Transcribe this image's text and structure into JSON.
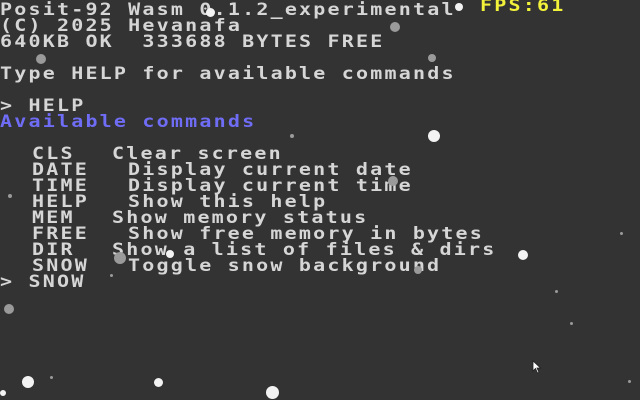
{
  "header": {
    "title": "Posit-92 Wasm 0.1.2_experimental",
    "copyright": "(C) 2025 Hevanafa",
    "memory": "640KB OK  333688 BYTES FREE"
  },
  "fps": "FPS:61",
  "prompt_hint": "Type HELP for available commands",
  "history": {
    "prompt_symbol": ">",
    "first_command": "HELP",
    "available_heading": "Available commands",
    "second_command": "SNOW"
  },
  "commands": [
    {
      "name": "CLS",
      "desc": "Clear screen"
    },
    {
      "name": "DATE",
      "desc": "Display current date"
    },
    {
      "name": "TIME",
      "desc": "Display current time"
    },
    {
      "name": "HELP",
      "desc": "Show this help"
    },
    {
      "name": "MEM",
      "desc": "Show memory status"
    },
    {
      "name": "FREE",
      "desc": "Show free memory in bytes"
    },
    {
      "name": "DIR",
      "desc": "Show a list of files & dirs"
    },
    {
      "name": "SNOW",
      "desc": "Toggle snow background"
    }
  ],
  "colors": {
    "background": "#333333",
    "text": "#d6d6d6",
    "highlight": "#6f6cf5",
    "fps": "#f2f23a",
    "snow": "#f3f3f3"
  }
}
